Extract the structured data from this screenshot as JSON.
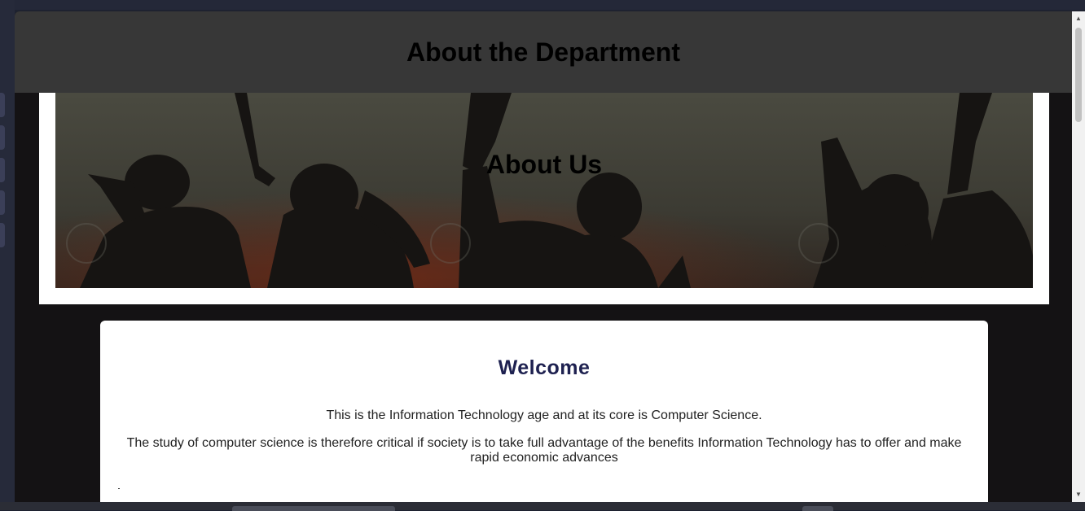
{
  "header": {
    "title": "About the Department"
  },
  "hero": {
    "title": "About Us"
  },
  "welcome": {
    "heading": "Welcome",
    "paragraph_1": "This is the Information Technology age and at its core is Computer Science.",
    "paragraph_2": "The study of computer science is therefore critical if society is to take full advantage of the benefits Information Technology has to offer and make rapid economic advances"
  },
  "scrollbar": {
    "up_icon": "▲",
    "down_icon": "▼"
  },
  "colors": {
    "header_bg": "#373737",
    "page_bg": "#141214",
    "welcome_heading": "#1e2150"
  }
}
